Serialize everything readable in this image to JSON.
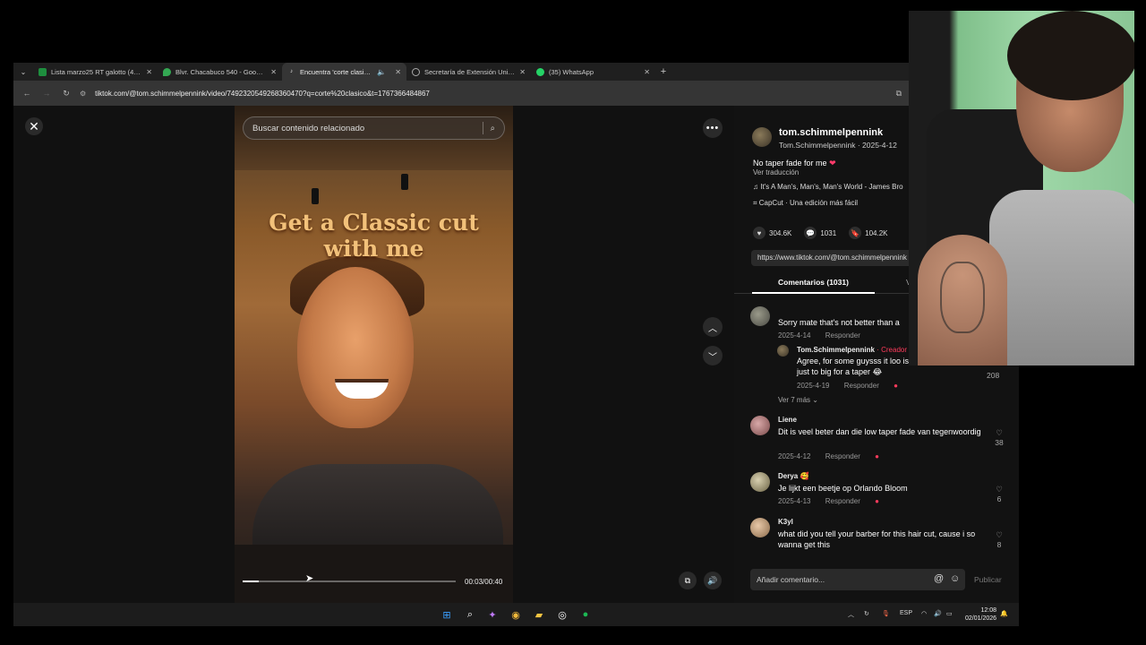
{
  "browser": {
    "tabs": [
      {
        "label": "Lista marzo25 RT galotto (4) - (",
        "icon": "sheets-icon",
        "color": "#1e8e3e",
        "active": false
      },
      {
        "label": "Blvr. Chacabuco 540 - Google M",
        "icon": "maps-icon",
        "color": "#34a853",
        "active": false
      },
      {
        "label": "Encuentra 'corte clasico' en",
        "icon": "tiktok-icon",
        "color": "#ffffff",
        "active": true
      },
      {
        "label": "Secretaría de Extensión Univers",
        "icon": "globe-icon",
        "color": "#aaaaaa",
        "active": false
      },
      {
        "label": "(35) WhatsApp",
        "icon": "whatsapp-icon",
        "color": "#25d366",
        "active": false
      }
    ],
    "url": "tiktok.com/@tom.schimmelpennink/video/7492320549268360470?q=corte%20clasico&t=1767366484867"
  },
  "video": {
    "search_placeholder": "Buscar contenido relacionado",
    "overlay_line1": "Get a Classic cut",
    "overlay_line2": "with me",
    "time": "00:03/00:40",
    "progress": 0.075
  },
  "post": {
    "username": "tom.schimmelpennink",
    "display_meta": "Tom.Schimmelpennink · 2025-4-12",
    "description": "No taper fade for me",
    "translate": "Ver traducción",
    "music": "It's A Man's, Man's, Man's World - James Bro",
    "capcut": "CapCut · Una edición más fácil",
    "likes": "304.6K",
    "comments": "1031",
    "saves": "104.2K",
    "link": "https://www.tiktok.com/@tom.schimmelpennink",
    "tab_comments": "Comentarios (1031)",
    "tab_other": "V"
  },
  "comments": [
    {
      "user": "",
      "text": "Sorry mate that's not better than a",
      "date": "2025-4-14",
      "reply": "Responder",
      "likes": ""
    },
    {
      "user": "Liene",
      "text": "Dit is veel beter dan die low taper fade van tegenwoordig",
      "date": "2025-4-12",
      "reply": "Responder",
      "likes": "38"
    },
    {
      "user": "Derya",
      "text": "Je lijkt een beetje op Orlando Bloom",
      "date": "2025-4-13",
      "reply": "Responder",
      "likes": "6"
    },
    {
      "user": "K3yl",
      "text": "what did you tell your barber for this hair cut, cause i so wanna get this",
      "date": "",
      "reply": "",
      "likes": "8"
    }
  ],
  "creator_reply": {
    "user": "Tom.Schimmelpennink",
    "badge": "· Creador",
    "text": "Agree, for some guysss it loo is just to big for a taper",
    "date": "2025-4-19",
    "reply": "Responder",
    "likes": "208",
    "more": "Ver 7 más ⌄"
  },
  "composer": {
    "placeholder": "Añadir comentario...",
    "publish": "Publicar"
  },
  "taskbar": {
    "lang": "ESP",
    "time": "12:08",
    "date": "02/01/2026"
  }
}
